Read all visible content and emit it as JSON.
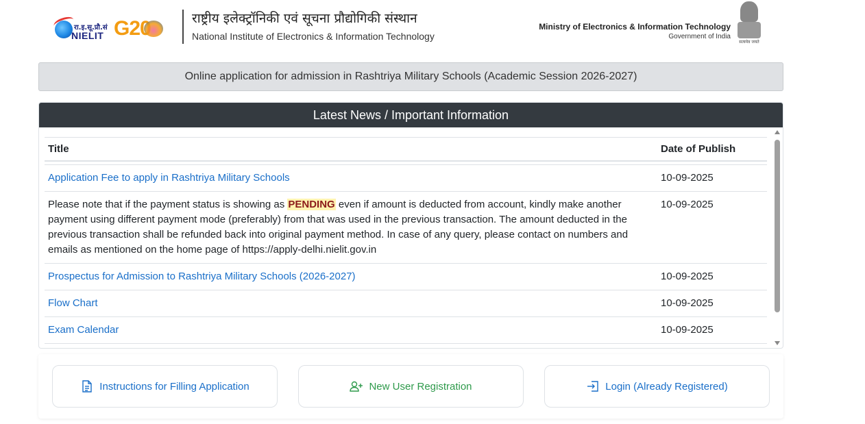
{
  "header": {
    "nielit_logo_hindi": "रा.इ.सू.प्रौ.सं",
    "nielit_logo_text": "NIELIT",
    "g20_text": "G20",
    "institute_name_hindi": "राष्ट्रीय इलेक्ट्रॉनिकी एवं सूचना प्रौद्योगिकी संस्थान",
    "institute_name_english": "National Institute of Electronics & Information Technology",
    "ministry": "Ministry of Electronics & Information Technology",
    "government": "Government of India",
    "emblem_text": "सत्यमेव जयते"
  },
  "banner": {
    "text": "Online application for admission in Rashtriya Military Schools (Academic Session 2026-2027)"
  },
  "news": {
    "heading": "Latest News / Important Information",
    "columns": {
      "title": "Title",
      "date": "Date of Publish"
    },
    "items": [
      {
        "title": "Application Fee to apply in Rashtriya Military Schools",
        "date": "10-09-2025",
        "is_link": true
      },
      {
        "text_before": "Please note that if the payment status is showing as ",
        "highlight": "PENDING",
        "text_after": " even if amount is deducted from account, kindly make another payment using different payment mode (preferably) from that was used in the previous transaction. The amount deducted in the previous transaction shall be refunded back into original payment method. In case of any query, please contact on numbers and emails as mentioned on the home page of https://apply-delhi.nielit.gov.in",
        "date": "10-09-2025",
        "is_link": false
      },
      {
        "title": "Prospectus for Admission to Rashtriya Military Schools (2026-2027)",
        "date": "10-09-2025",
        "is_link": true
      },
      {
        "title": "Flow Chart",
        "date": "10-09-2025",
        "is_link": true
      },
      {
        "title": "Exam Calendar",
        "date": "10-09-2025",
        "is_link": true
      }
    ]
  },
  "actions": {
    "instructions_label": "Instructions for Filling Application",
    "register_label": "New User Registration",
    "login_label": "Login (Already Registered)"
  },
  "colors": {
    "link": "#1a6fc9",
    "register": "#2e9a4b",
    "news_header_bg": "#343a40",
    "banner_bg": "#dfe1e4",
    "pending_highlight": "#fff3b0"
  },
  "icons": {
    "instructions": "file-text-icon",
    "register": "person-plus-icon",
    "login": "box-arrow-in-right-icon"
  }
}
